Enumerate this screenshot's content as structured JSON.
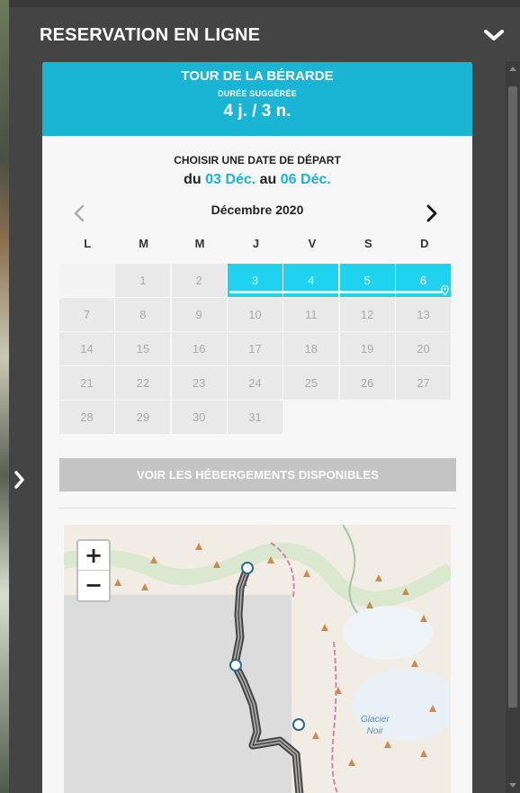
{
  "panel": {
    "title": "RESERVATION EN LIGNE"
  },
  "tour": {
    "name": "TOUR DE LA BÉRARDE",
    "duration_label": "DURÉE SUGGÉRÉE",
    "duration_value": "4 j. / 3 n."
  },
  "calendar": {
    "choose_label": "CHOISIR UNE DATE DE DÉPART",
    "range_prefix": "du",
    "range_start": "03 Déc.",
    "range_mid": "au",
    "range_end": "06 Déc.",
    "month_label": "Décembre 2020",
    "weekdays": [
      "L",
      "M",
      "M",
      "J",
      "V",
      "S",
      "D"
    ],
    "days": [
      "",
      "1",
      "2",
      "3",
      "4",
      "5",
      "6",
      "7",
      "8",
      "9",
      "10",
      "11",
      "12",
      "13",
      "14",
      "15",
      "16",
      "17",
      "18",
      "19",
      "20",
      "21",
      "22",
      "23",
      "24",
      "25",
      "26",
      "27",
      "28",
      "29",
      "30",
      "31",
      "",
      "",
      ""
    ],
    "selected_days": [
      "3",
      "4",
      "5",
      "6"
    ]
  },
  "actions": {
    "voir_label": "VOIR LES HÉBERGEMENTS DISPONIBLES"
  },
  "map": {
    "zoom_in": "+",
    "zoom_out": "−",
    "glacier_line1": "Glacier",
    "glacier_line2": "Noir"
  },
  "colors": {
    "accent": "#1ab5d4",
    "selected": "#1fd2ef",
    "button_disabled": "#c4c4c4"
  }
}
